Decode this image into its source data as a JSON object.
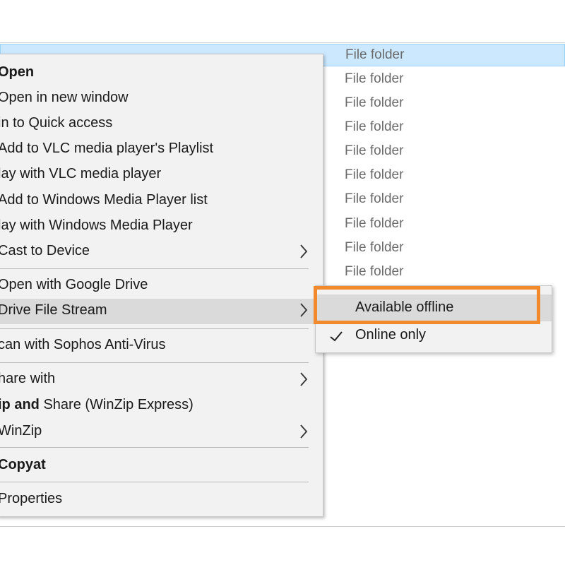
{
  "file_list": {
    "rows": [
      {
        "type": "File folder",
        "selected": true
      },
      {
        "type": "File folder"
      },
      {
        "type": "File folder"
      },
      {
        "type": "File folder"
      },
      {
        "type": "File folder"
      },
      {
        "type": "File folder"
      },
      {
        "type": "File folder"
      },
      {
        "type": "File folder"
      },
      {
        "type": "File folder"
      },
      {
        "type": "File folder"
      }
    ]
  },
  "context_menu": {
    "items": [
      {
        "label": "Open",
        "bold": true
      },
      {
        "label": "Open in new window"
      },
      {
        "label": "Pin to Quick access",
        "display": "in to Quick access"
      },
      {
        "label": "Add to VLC media player's Playlist",
        "display": "Add to VLC media player's Playlist"
      },
      {
        "label": "Play with VLC media player",
        "display": "lay with VLC media player"
      },
      {
        "label": "Add to Windows Media Player list",
        "display": "Add to Windows Media Player list"
      },
      {
        "label": "Play with Windows Media Player",
        "display": "lay with Windows Media Player"
      },
      {
        "label": "Cast to Device",
        "display": "Cast to Device",
        "submenu": true
      },
      {
        "label": "Open with Google Drive"
      },
      {
        "label": "Drive File Stream",
        "submenu": true,
        "highlighted": true
      },
      {
        "label": "Scan with Sophos Anti-Virus",
        "display": "can with Sophos Anti-Virus"
      },
      {
        "label": "Share with",
        "display": "hare with",
        "submenu": true
      },
      {
        "label_bold": "ip and",
        "label_rest": " Share (WinZip Express)"
      },
      {
        "label": "WinZip",
        "display": "WinZip",
        "submenu": true
      },
      {
        "label": "Copy",
        "display": "Copyat",
        "bold": true
      },
      {
        "label": "Properties"
      }
    ]
  },
  "submenu": {
    "items": [
      {
        "label": "Available offline",
        "highlighted": true
      },
      {
        "label": "Online only",
        "checked": true
      }
    ]
  },
  "colors": {
    "highlight_box": "#f28a2c",
    "selection": "#cce8ff"
  }
}
